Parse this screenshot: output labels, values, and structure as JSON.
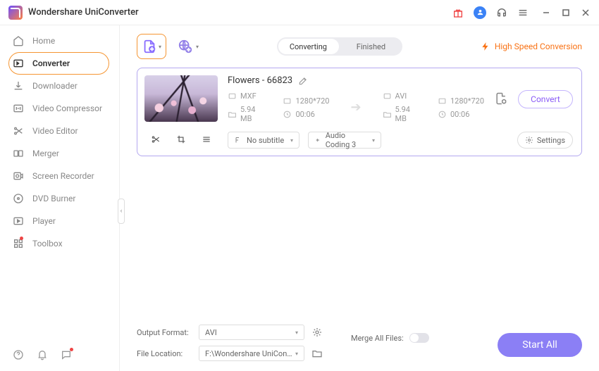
{
  "app_title": "Wondershare UniConverter",
  "sidebar": {
    "items": [
      {
        "label": "Home"
      },
      {
        "label": "Converter"
      },
      {
        "label": "Downloader"
      },
      {
        "label": "Video Compressor"
      },
      {
        "label": "Video Editor"
      },
      {
        "label": "Merger"
      },
      {
        "label": "Screen Recorder"
      },
      {
        "label": "DVD Burner"
      },
      {
        "label": "Player"
      },
      {
        "label": "Toolbox"
      }
    ]
  },
  "tabs": {
    "converting": "Converting",
    "finished": "Finished"
  },
  "hsc_label": "High Speed Conversion",
  "file": {
    "title": "Flowers - 66823",
    "src_format": "MXF",
    "dst_format": "AVI",
    "src_res": "1280*720",
    "dst_res": "1280*720",
    "src_size": "5.94 MB",
    "dst_size": "5.94 MB",
    "src_dur": "00:06",
    "dst_dur": "00:06",
    "subtitle": "No subtitle",
    "audio": "Audio Coding 3",
    "settings_label": "Settings",
    "convert_label": "Convert"
  },
  "bottom": {
    "output_format_label": "Output Format:",
    "output_format_value": "AVI",
    "file_location_label": "File Location:",
    "file_location_value": "F:\\Wondershare UniConverter",
    "merge_label": "Merge All Files:",
    "start_all": "Start All"
  }
}
